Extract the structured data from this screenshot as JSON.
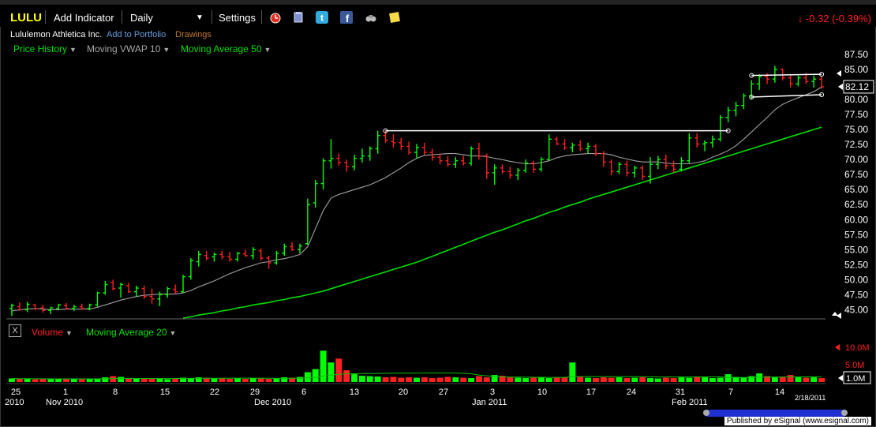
{
  "toolbar": {
    "ticker": "LULU",
    "add_indicator": "Add Indicator",
    "interval": "Daily",
    "settings": "Settings",
    "change": "-0.32 (-0.39%)"
  },
  "header": {
    "company": "Lululemon Athletica Inc.",
    "add_portfolio": "Add to Portfolio",
    "drawings": "Drawings"
  },
  "studies": {
    "price_history": "Price History",
    "vwap": "Moving VWAP 10",
    "ma50": "Moving Average 50",
    "volume": "Volume",
    "ma20": "Moving Average 20"
  },
  "footer": {
    "published": "Published by eSignal (www.esignal.com)",
    "date_stamp": "2/18/2011"
  },
  "colors": {
    "up": "#00ff00",
    "down": "#ff2020",
    "vwap": "#a0a0a0",
    "ma50": "#00dd00",
    "trendline": "#ffffff",
    "bg": "#000000"
  },
  "chart_data": {
    "type": "bar",
    "price_axis": {
      "ylim": [
        44,
        87.5
      ],
      "ticks": [
        "87.50",
        "85.00",
        "82.50",
        "80.00",
        "77.50",
        "75.00",
        "72.50",
        "70.00",
        "67.50",
        "65.00",
        "62.50",
        "60.00",
        "57.50",
        "55.00",
        "52.50",
        "50.00",
        "47.50",
        "45.00"
      ],
      "last_price": "82.12"
    },
    "volume_axis": {
      "ticks": [
        "10.0M",
        "5.0M"
      ],
      "last_volume": "1.0M"
    },
    "x_ticks": [
      "25",
      "1",
      "8",
      "15",
      "22",
      "29",
      "6",
      "13",
      "20",
      "27",
      "3",
      "10",
      "17",
      "24",
      "31",
      "7",
      "14"
    ],
    "x_month_labels": [
      "2010",
      "Nov 2010",
      "Dec 2010",
      "Jan 2011",
      "Feb 2011"
    ],
    "bars": [
      {
        "o": 45.2,
        "h": 46.0,
        "l": 44.0,
        "c": 45.7
      },
      {
        "o": 45.5,
        "h": 46.2,
        "l": 44.8,
        "c": 45.0
      },
      {
        "o": 45.0,
        "h": 46.3,
        "l": 44.6,
        "c": 45.9
      },
      {
        "o": 45.8,
        "h": 46.0,
        "l": 44.9,
        "c": 45.2
      },
      {
        "o": 45.3,
        "h": 45.8,
        "l": 44.5,
        "c": 44.9
      },
      {
        "o": 44.9,
        "h": 45.5,
        "l": 44.3,
        "c": 45.3
      },
      {
        "o": 45.2,
        "h": 46.0,
        "l": 44.9,
        "c": 45.8
      },
      {
        "o": 45.7,
        "h": 46.1,
        "l": 45.0,
        "c": 45.2
      },
      {
        "o": 45.2,
        "h": 45.8,
        "l": 44.8,
        "c": 45.5
      },
      {
        "o": 45.5,
        "h": 46.0,
        "l": 45.0,
        "c": 45.2
      },
      {
        "o": 45.2,
        "h": 46.0,
        "l": 44.9,
        "c": 45.8
      },
      {
        "o": 45.8,
        "h": 48.0,
        "l": 45.5,
        "c": 47.8
      },
      {
        "o": 47.8,
        "h": 49.8,
        "l": 47.5,
        "c": 49.2
      },
      {
        "o": 49.5,
        "h": 50.0,
        "l": 48.2,
        "c": 48.5
      },
      {
        "o": 48.6,
        "h": 49.5,
        "l": 47.0,
        "c": 49.2
      },
      {
        "o": 49.0,
        "h": 49.5,
        "l": 47.8,
        "c": 48.0
      },
      {
        "o": 48.0,
        "h": 49.0,
        "l": 47.2,
        "c": 48.6
      },
      {
        "o": 48.5,
        "h": 49.0,
        "l": 46.8,
        "c": 47.2
      },
      {
        "o": 47.2,
        "h": 48.5,
        "l": 46.0,
        "c": 46.8
      },
      {
        "o": 46.8,
        "h": 48.0,
        "l": 45.6,
        "c": 47.5
      },
      {
        "o": 47.5,
        "h": 48.8,
        "l": 47.0,
        "c": 48.5
      },
      {
        "o": 48.4,
        "h": 49.2,
        "l": 47.6,
        "c": 48.0
      },
      {
        "o": 48.0,
        "h": 50.8,
        "l": 47.8,
        "c": 50.5
      },
      {
        "o": 50.5,
        "h": 53.6,
        "l": 50.0,
        "c": 53.2
      },
      {
        "o": 53.0,
        "h": 54.8,
        "l": 52.2,
        "c": 54.2
      },
      {
        "o": 54.0,
        "h": 54.8,
        "l": 53.2,
        "c": 53.6
      },
      {
        "o": 53.8,
        "h": 54.5,
        "l": 53.0,
        "c": 54.2
      },
      {
        "o": 54.2,
        "h": 54.8,
        "l": 53.4,
        "c": 53.8
      },
      {
        "o": 53.8,
        "h": 54.6,
        "l": 53.0,
        "c": 53.4
      },
      {
        "o": 53.4,
        "h": 54.6,
        "l": 53.0,
        "c": 54.4
      },
      {
        "o": 54.3,
        "h": 55.0,
        "l": 53.8,
        "c": 54.0
      },
      {
        "o": 54.0,
        "h": 55.4,
        "l": 53.4,
        "c": 55.0
      },
      {
        "o": 54.8,
        "h": 55.2,
        "l": 53.2,
        "c": 53.6
      },
      {
        "o": 53.6,
        "h": 54.0,
        "l": 51.8,
        "c": 52.8
      },
      {
        "o": 52.8,
        "h": 54.8,
        "l": 52.5,
        "c": 54.4
      },
      {
        "o": 54.4,
        "h": 56.0,
        "l": 54.0,
        "c": 55.5
      },
      {
        "o": 55.5,
        "h": 56.2,
        "l": 54.8,
        "c": 55.0
      },
      {
        "o": 55.0,
        "h": 56.0,
        "l": 54.4,
        "c": 55.6
      },
      {
        "o": 56.0,
        "h": 63.5,
        "l": 55.8,
        "c": 62.5
      },
      {
        "o": 62.8,
        "h": 66.6,
        "l": 62.0,
        "c": 66.0
      },
      {
        "o": 66.0,
        "h": 70.2,
        "l": 65.0,
        "c": 69.8
      },
      {
        "o": 69.8,
        "h": 73.4,
        "l": 68.5,
        "c": 70.2
      },
      {
        "o": 70.2,
        "h": 71.0,
        "l": 69.0,
        "c": 69.5
      },
      {
        "o": 69.5,
        "h": 70.0,
        "l": 68.0,
        "c": 68.8
      },
      {
        "o": 68.8,
        "h": 70.8,
        "l": 68.2,
        "c": 70.2
      },
      {
        "o": 70.2,
        "h": 71.8,
        "l": 69.5,
        "c": 70.6
      },
      {
        "o": 70.6,
        "h": 72.2,
        "l": 69.8,
        "c": 71.8
      },
      {
        "o": 71.8,
        "h": 74.8,
        "l": 71.0,
        "c": 74.0
      },
      {
        "o": 74.0,
        "h": 74.8,
        "l": 72.8,
        "c": 73.2
      },
      {
        "o": 73.0,
        "h": 74.2,
        "l": 72.0,
        "c": 72.8
      },
      {
        "o": 72.8,
        "h": 73.6,
        "l": 71.6,
        "c": 72.2
      },
      {
        "o": 72.2,
        "h": 73.0,
        "l": 70.8,
        "c": 71.2
      },
      {
        "o": 71.2,
        "h": 72.6,
        "l": 70.2,
        "c": 72.0
      },
      {
        "o": 72.0,
        "h": 72.8,
        "l": 70.8,
        "c": 71.2
      },
      {
        "o": 71.2,
        "h": 71.8,
        "l": 69.8,
        "c": 70.4
      },
      {
        "o": 70.4,
        "h": 71.0,
        "l": 69.2,
        "c": 69.8
      },
      {
        "o": 69.8,
        "h": 70.6,
        "l": 68.8,
        "c": 69.2
      },
      {
        "o": 69.2,
        "h": 70.4,
        "l": 68.6,
        "c": 69.8
      },
      {
        "o": 69.8,
        "h": 70.6,
        "l": 69.0,
        "c": 69.4
      },
      {
        "o": 69.4,
        "h": 72.2,
        "l": 69.0,
        "c": 71.8
      },
      {
        "o": 71.8,
        "h": 72.8,
        "l": 70.0,
        "c": 70.6
      },
      {
        "o": 70.6,
        "h": 71.0,
        "l": 66.8,
        "c": 67.8
      },
      {
        "o": 67.8,
        "h": 69.2,
        "l": 65.8,
        "c": 68.6
      },
      {
        "o": 68.6,
        "h": 69.2,
        "l": 67.6,
        "c": 68.0
      },
      {
        "o": 68.0,
        "h": 68.8,
        "l": 66.8,
        "c": 67.4
      },
      {
        "o": 67.4,
        "h": 68.6,
        "l": 66.6,
        "c": 68.2
      },
      {
        "o": 68.2,
        "h": 70.0,
        "l": 67.8,
        "c": 69.4
      },
      {
        "o": 69.4,
        "h": 69.8,
        "l": 67.8,
        "c": 68.4
      },
      {
        "o": 68.4,
        "h": 70.4,
        "l": 68.0,
        "c": 70.0
      },
      {
        "o": 70.0,
        "h": 74.2,
        "l": 69.8,
        "c": 73.4
      },
      {
        "o": 73.4,
        "h": 73.8,
        "l": 72.4,
        "c": 72.6
      },
      {
        "o": 72.6,
        "h": 73.4,
        "l": 71.6,
        "c": 72.0
      },
      {
        "o": 72.0,
        "h": 72.8,
        "l": 71.2,
        "c": 72.4
      },
      {
        "o": 72.4,
        "h": 73.2,
        "l": 71.4,
        "c": 71.8
      },
      {
        "o": 71.8,
        "h": 72.8,
        "l": 71.0,
        "c": 72.2
      },
      {
        "o": 72.2,
        "h": 72.6,
        "l": 70.6,
        "c": 71.0
      },
      {
        "o": 71.0,
        "h": 71.4,
        "l": 68.8,
        "c": 69.6
      },
      {
        "o": 69.6,
        "h": 70.0,
        "l": 67.4,
        "c": 68.0
      },
      {
        "o": 68.0,
        "h": 69.6,
        "l": 67.6,
        "c": 69.2
      },
      {
        "o": 69.2,
        "h": 69.8,
        "l": 67.2,
        "c": 67.8
      },
      {
        "o": 67.8,
        "h": 69.0,
        "l": 67.0,
        "c": 68.6
      },
      {
        "o": 68.6,
        "h": 69.0,
        "l": 66.6,
        "c": 67.2
      },
      {
        "o": 67.2,
        "h": 70.4,
        "l": 66.0,
        "c": 69.2
      },
      {
        "o": 69.2,
        "h": 70.6,
        "l": 68.4,
        "c": 70.0
      },
      {
        "o": 70.0,
        "h": 70.8,
        "l": 68.4,
        "c": 69.0
      },
      {
        "o": 69.0,
        "h": 69.8,
        "l": 67.8,
        "c": 68.4
      },
      {
        "o": 68.4,
        "h": 70.4,
        "l": 68.0,
        "c": 69.8
      },
      {
        "o": 69.8,
        "h": 74.4,
        "l": 69.4,
        "c": 73.6
      },
      {
        "o": 73.6,
        "h": 74.4,
        "l": 72.0,
        "c": 72.6
      },
      {
        "o": 72.6,
        "h": 73.2,
        "l": 71.4,
        "c": 72.8
      },
      {
        "o": 72.8,
        "h": 74.0,
        "l": 72.0,
        "c": 73.4
      },
      {
        "o": 73.4,
        "h": 77.4,
        "l": 73.0,
        "c": 77.0
      },
      {
        "o": 77.0,
        "h": 78.8,
        "l": 76.2,
        "c": 78.2
      },
      {
        "o": 78.2,
        "h": 79.6,
        "l": 77.2,
        "c": 79.0
      },
      {
        "o": 79.0,
        "h": 81.0,
        "l": 78.4,
        "c": 80.6
      },
      {
        "o": 80.6,
        "h": 83.2,
        "l": 80.0,
        "c": 82.6
      },
      {
        "o": 82.6,
        "h": 84.2,
        "l": 81.6,
        "c": 83.8
      },
      {
        "o": 83.8,
        "h": 84.4,
        "l": 82.6,
        "c": 83.4
      },
      {
        "o": 83.4,
        "h": 85.6,
        "l": 82.8,
        "c": 85.0
      },
      {
        "o": 85.0,
        "h": 85.2,
        "l": 83.2,
        "c": 83.6
      },
      {
        "o": 83.6,
        "h": 84.2,
        "l": 82.0,
        "c": 82.6
      },
      {
        "o": 82.6,
        "h": 84.0,
        "l": 82.2,
        "c": 83.6
      },
      {
        "o": 83.6,
        "h": 84.4,
        "l": 82.6,
        "c": 83.0
      },
      {
        "o": 83.0,
        "h": 84.0,
        "l": 82.0,
        "c": 83.4
      },
      {
        "o": 83.4,
        "h": 84.0,
        "l": 81.8,
        "c": 82.12
      }
    ],
    "vwap10": [
      44.8,
      45.0,
      45.1,
      45.2,
      45.1,
      45.0,
      45.0,
      45.1,
      45.1,
      45.1,
      45.1,
      45.4,
      45.8,
      46.2,
      46.6,
      46.9,
      47.2,
      47.4,
      47.5,
      47.6,
      47.6,
      47.6,
      47.8,
      48.2,
      48.8,
      49.3,
      49.8,
      50.4,
      51.0,
      51.5,
      52.0,
      52.4,
      52.8,
      53.0,
      53.3,
      53.5,
      53.8,
      54.2,
      55.5,
      58.5,
      61.5,
      63.6,
      64.2,
      64.6,
      65.0,
      65.4,
      65.8,
      66.4,
      67.0,
      67.8,
      68.6,
      69.5,
      70.2,
      70.7,
      70.8,
      70.9,
      71.0,
      71.0,
      70.8,
      70.6,
      70.6,
      70.5,
      70.2,
      70.0,
      69.7,
      69.5,
      69.3,
      69.3,
      69.5,
      69.8,
      70.3,
      70.6,
      70.8,
      70.9,
      71.0,
      71.0,
      71.0,
      70.8,
      70.4,
      70.1,
      69.8,
      69.6,
      69.6,
      69.6,
      69.4,
      69.3,
      69.3,
      69.3,
      69.5,
      69.8,
      70.4,
      70.9,
      71.5,
      72.3,
      73.4,
      74.6,
      75.8,
      77.0,
      78.3,
      79.2,
      79.8,
      80.3,
      80.8,
      81.3,
      82.1
    ],
    "ma50": [
      null,
      null,
      null,
      null,
      null,
      null,
      null,
      null,
      null,
      null,
      null,
      null,
      null,
      null,
      null,
      null,
      null,
      null,
      null,
      null,
      null,
      null,
      43.6,
      43.8,
      44.1,
      44.3,
      44.5,
      44.8,
      45.0,
      45.3,
      45.5,
      45.8,
      46.0,
      46.2,
      46.5,
      46.7,
      47.0,
      47.2,
      47.5,
      47.8,
      48.1,
      48.5,
      48.9,
      49.3,
      49.7,
      50.1,
      50.5,
      50.9,
      51.3,
      51.7,
      52.1,
      52.5,
      52.9,
      53.4,
      53.9,
      54.4,
      54.9,
      55.4,
      55.9,
      56.4,
      56.9,
      57.4,
      57.9,
      58.3,
      58.8,
      59.3,
      59.8,
      60.2,
      60.7,
      61.2,
      61.6,
      62.1,
      62.5,
      62.9,
      63.4,
      63.8,
      64.2,
      64.6,
      65.0,
      65.4,
      65.8,
      66.2,
      66.6,
      67.0,
      67.4,
      67.8,
      68.2,
      68.6,
      69.0,
      69.4,
      69.8,
      70.2,
      70.6,
      71.0,
      71.4,
      71.8,
      72.2,
      72.6,
      73.0,
      73.4,
      73.8,
      74.2,
      74.6,
      75.0,
      75.4
    ],
    "volume_millions": [
      0.9,
      0.8,
      0.9,
      0.7,
      0.8,
      0.7,
      0.8,
      0.9,
      0.8,
      0.7,
      0.8,
      0.9,
      1.2,
      1.5,
      1.3,
      1.0,
      0.9,
      0.8,
      0.9,
      0.8,
      0.7,
      0.9,
      1.1,
      1.0,
      1.2,
      1.1,
      0.9,
      1.0,
      0.8,
      0.9,
      0.8,
      1.0,
      0.9,
      0.8,
      1.0,
      1.2,
      1.1,
      1.3,
      2.5,
      3.3,
      8.0,
      5.0,
      6.0,
      3.0,
      2.0,
      1.6,
      1.5,
      1.4,
      1.2,
      1.3,
      1.1,
      1.2,
      1.1,
      1.2,
      1.0,
      1.1,
      1.3,
      1.2,
      1.1,
      1.0,
      1.5,
      1.2,
      1.8,
      1.6,
      1.2,
      1.1,
      1.0,
      1.1,
      1.2,
      1.0,
      1.1,
      1.2,
      5.0,
      1.3,
      1.1,
      1.0,
      1.2,
      1.1,
      1.2,
      1.0,
      1.1,
      1.2,
      1.0,
      0.9,
      1.1,
      1.0,
      1.2,
      1.1,
      1.3,
      1.2,
      1.0,
      1.1,
      2.0,
      1.3,
      1.2,
      1.5,
      2.2,
      1.5,
      1.3,
      1.4,
      1.8,
      1.2,
      1.1,
      1.2,
      1.0
    ],
    "trendlines": [
      {
        "x0": 48,
        "y0": 74.8,
        "x1": 92,
        "y1": 74.8
      },
      {
        "x0": 95,
        "y0": 84.0,
        "x1": 104,
        "y1": 84.2
      },
      {
        "x0": 95,
        "y0": 80.4,
        "x1": 104,
        "y1": 80.8
      }
    ]
  }
}
